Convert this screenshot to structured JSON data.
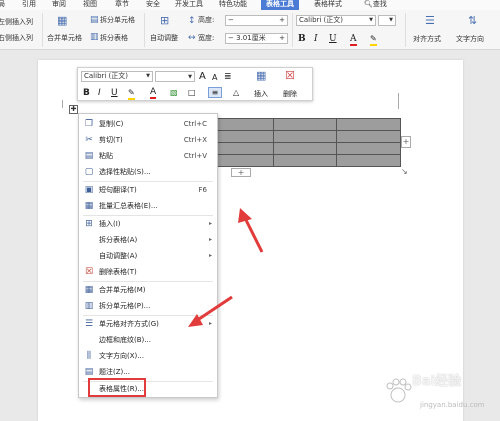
{
  "menubar": {
    "tabs": [
      "局",
      "引用",
      "审阅",
      "视图",
      "章节",
      "安全",
      "开发工具",
      "特色功能",
      "表格工具",
      "表格样式",
      "查找"
    ]
  },
  "ribbon": {
    "insert_left_col": "左侧插入列",
    "insert_right_col": "右侧插入列",
    "merge_cells": "合并单元格",
    "split_cells": "拆分单元格",
    "split_table": "拆分表格",
    "auto_fit": "自动调整",
    "height_label": "高度:",
    "width_label": "宽度:",
    "height_value": "",
    "width_value": "3.01厘米",
    "font_name": "Calibri (正文)",
    "bold": "B",
    "italic": "I",
    "underline": "U",
    "font_color": "A",
    "align": "对齐方式",
    "text_direction": "文字方向"
  },
  "mini_toolbar": {
    "font_name": "Calibri (正文)",
    "grow_font": "A",
    "shrink_font": "A",
    "insert": "插入",
    "delete": "删除",
    "bold": "B",
    "italic": "I",
    "underline": "U",
    "font_color": "A"
  },
  "context_menu": {
    "items": [
      {
        "label": "复制(C)",
        "shortcut": "Ctrl+C",
        "icon": "copy-icon"
      },
      {
        "label": "剪切(T)",
        "shortcut": "Ctrl+X",
        "icon": "cut-icon"
      },
      {
        "label": "粘贴",
        "shortcut": "Ctrl+V",
        "icon": "paste-icon"
      },
      {
        "label": "选择性粘贴(S)...",
        "shortcut": "",
        "icon": "paste-special-icon"
      },
      {
        "label": "短句翻译(T)",
        "shortcut": "F6",
        "icon": "translate-icon"
      },
      {
        "label": "批量汇总表格(E)...",
        "shortcut": "",
        "icon": "summary-icon"
      },
      {
        "label": "插入(I)",
        "shortcut": "",
        "icon": "insert-icon"
      },
      {
        "label": "拆分表格(A)",
        "shortcut": "",
        "icon": ""
      },
      {
        "label": "自动调整(A)",
        "shortcut": "",
        "icon": ""
      },
      {
        "label": "删除表格(T)",
        "shortcut": "",
        "icon": "delete-table-icon"
      },
      {
        "label": "合并单元格(M)",
        "shortcut": "",
        "icon": "merge-icon"
      },
      {
        "label": "拆分单元格(P)...",
        "shortcut": "",
        "icon": "split-icon"
      },
      {
        "label": "单元格对齐方式(G)",
        "shortcut": "",
        "icon": "align-icon"
      },
      {
        "label": "边框和底纹(B)...",
        "shortcut": "",
        "icon": ""
      },
      {
        "label": "文字方向(X)...",
        "shortcut": "",
        "icon": "text-direction-icon"
      },
      {
        "label": "题注(Z)...",
        "shortcut": "",
        "icon": "caption-icon"
      },
      {
        "label": "表格属性(R)...",
        "shortcut": "",
        "icon": ""
      }
    ]
  },
  "watermark": {
    "brand": "Bai经验",
    "url": "jingyan.baidu.com"
  },
  "colors": {
    "active_tab": "#4b7bd4",
    "highlight": "#e23b3b",
    "table_fill": "#9d9d9d"
  }
}
